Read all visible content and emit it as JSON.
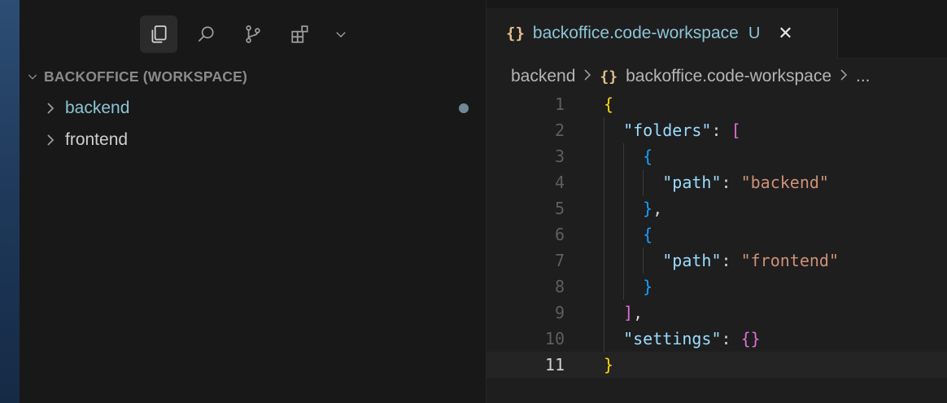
{
  "sidebar": {
    "activity_icons": [
      "explorer-icon",
      "search-icon",
      "source-control-icon",
      "extensions-icon",
      "chevron-down-icon"
    ],
    "section_title": "BACKOFFICE (WORKSPACE)",
    "items": [
      {
        "label": "backend",
        "modified": true
      },
      {
        "label": "frontend",
        "modified": false
      }
    ]
  },
  "editor": {
    "tab": {
      "icon": "{}",
      "name": "backoffice.code-workspace",
      "status": "U",
      "close": "✕"
    },
    "breadcrumb": {
      "folder": "backend",
      "icon": "{}",
      "file": "backoffice.code-workspace",
      "more": "..."
    },
    "line_numbers": [
      "1",
      "2",
      "3",
      "4",
      "5",
      "6",
      "7",
      "8",
      "9",
      "10",
      "11"
    ],
    "current_line": "11",
    "code": {
      "l1_open": "{",
      "folders_key": "\"folders\"",
      "colon": ":",
      "array_open": "[",
      "obj_open": "{",
      "path_key": "\"path\"",
      "backend_val": "\"backend\"",
      "obj_close": "}",
      "comma": ",",
      "frontend_val": "\"frontend\"",
      "array_close": "]",
      "settings_key": "\"settings\"",
      "settings_val": "{}",
      "l11_close": "}"
    }
  },
  "colors": {
    "traffic_red": "#ff5f57",
    "traffic_yellow": "#febc2e",
    "traffic_green": "#28c840",
    "folder_accent": "#8cc4d6",
    "modified_dot": "#6e8a97"
  }
}
